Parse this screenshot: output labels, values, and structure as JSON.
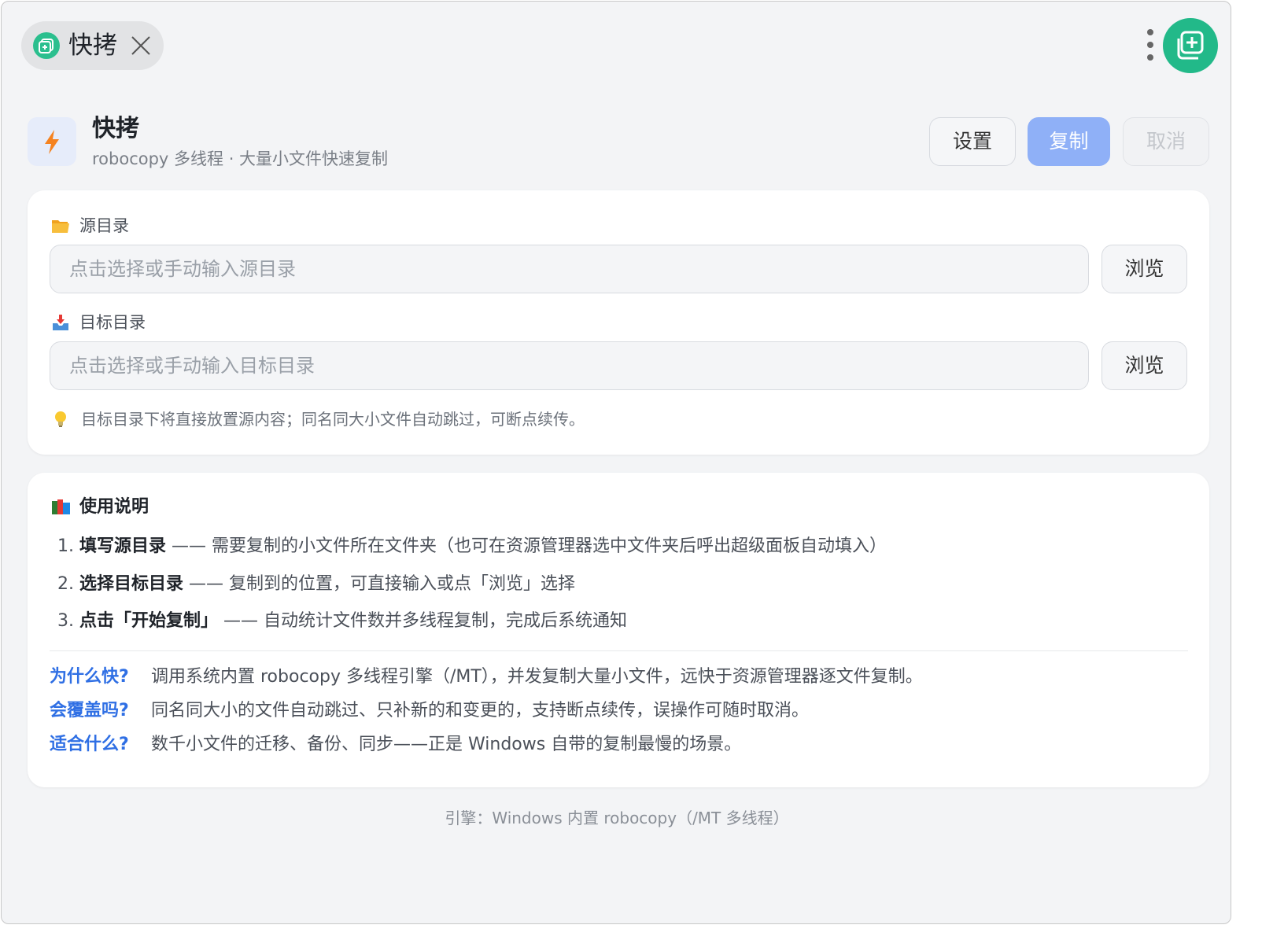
{
  "tab": {
    "title": "快拷"
  },
  "header": {
    "title": "快拷",
    "subtitle": "robocopy 多线程 · 大量小文件快速复制",
    "buttons": {
      "settings": "设置",
      "copy": "复制",
      "cancel": "取消"
    }
  },
  "source": {
    "label": "源目录",
    "placeholder": "点击选择或手动输入源目录",
    "browse": "浏览"
  },
  "target": {
    "label": "目标目录",
    "placeholder": "点击选择或手动输入目标目录",
    "browse": "浏览"
  },
  "tip": "目标目录下将直接放置源内容；同名同大小文件自动跳过，可断点续传。",
  "guide": {
    "title": "使用说明",
    "steps": [
      {
        "num": "1.",
        "bold": "填写源目录",
        "text": " —— 需要复制的小文件所在文件夹（也可在资源管理器选中文件夹后呼出超级面板自动填入）"
      },
      {
        "num": "2.",
        "bold": "选择目标目录",
        "text": " —— 复制到的位置，可直接输入或点「浏览」选择"
      },
      {
        "num": "3.",
        "bold": "点击「开始复制」",
        "text": " —— 自动统计文件数并多线程复制，完成后系统通知"
      }
    ],
    "faq": [
      {
        "q": "为什么快?",
        "a": "调用系统内置 robocopy 多线程引擎（/MT），并发复制大量小文件，远快于资源管理器逐文件复制。"
      },
      {
        "q": "会覆盖吗?",
        "a": "同名同大小的文件自动跳过、只补新的和变更的，支持断点续传，误操作可随时取消。"
      },
      {
        "q": "适合什么?",
        "a": "数千小文件的迁移、备份、同步——正是 Windows 自带的复制最慢的场景。"
      }
    ]
  },
  "footer": "引擎：Windows 内置 robocopy（/MT 多线程）",
  "colors": {
    "accent_green": "#22b989",
    "primary_blue": "#8fb0f7",
    "link_blue": "#2f6fe4",
    "bolt_orange": "#f5821f"
  },
  "icons": [
    "copy-plus-icon",
    "close-icon",
    "kebab-menu-icon",
    "lightning-icon",
    "folder-icon",
    "inbox-tray-icon",
    "lightbulb-icon",
    "books-icon"
  ]
}
